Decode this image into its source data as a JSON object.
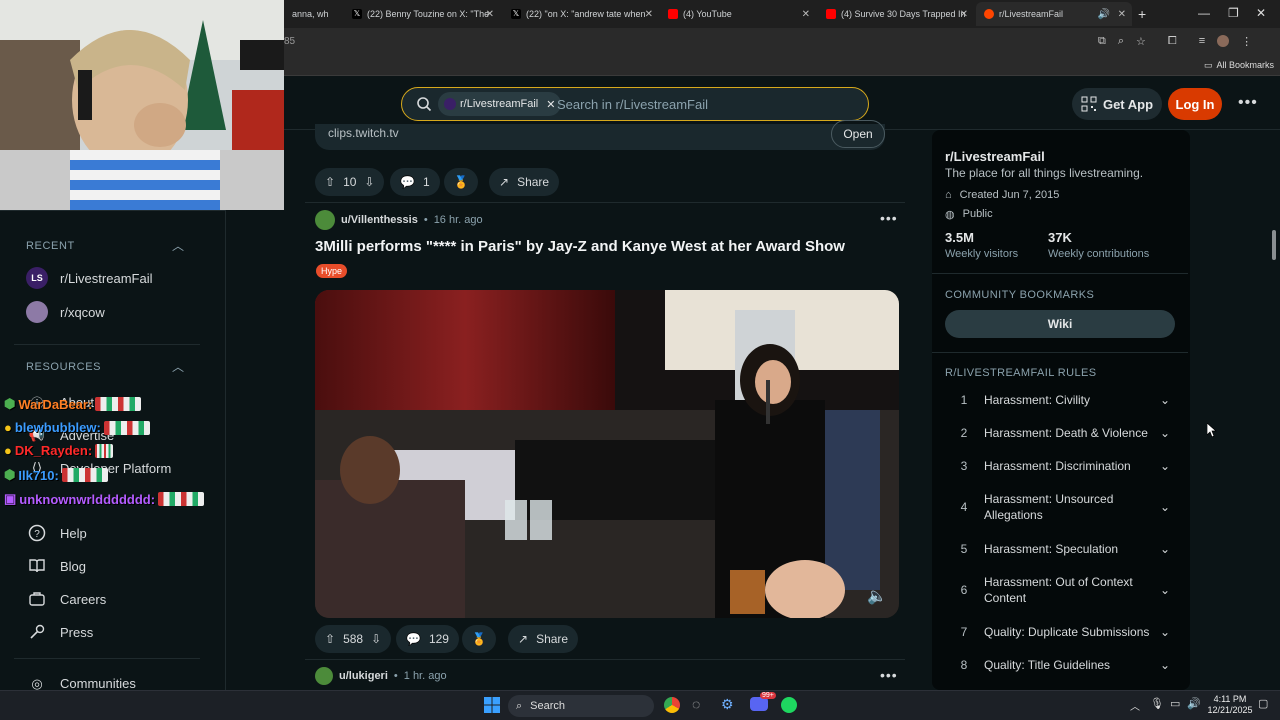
{
  "browser": {
    "tabs": [
      {
        "title": "anna, wh",
        "icon": "x-icon"
      },
      {
        "title": "(22) Benny Touzine on X: \"The",
        "icon": "x-icon"
      },
      {
        "title": "(22) \"on X: \"andrew tate when",
        "icon": "x-icon"
      },
      {
        "title": "(4) YouTube",
        "icon": "youtube-icon"
      },
      {
        "title": "(4) Survive 30 Days Trapped In",
        "icon": "youtube-icon"
      },
      {
        "title": "r/LivestreamFail",
        "icon": "reddit-icon"
      }
    ],
    "address_partial": "85",
    "bookmarks_label": "All Bookmarks"
  },
  "header": {
    "search_chip": "r/LivestreamFail",
    "search_placeholder": "Search in r/LivestreamFail",
    "get_app": "Get App",
    "login": "Log In"
  },
  "sidebar": {
    "recent_title": "RECENT",
    "recent": [
      {
        "label": "r/LivestreamFail",
        "avatar": "LS"
      },
      {
        "label": "r/xqcow",
        "avatar": ""
      }
    ],
    "resources_title": "RESOURCES",
    "resources": [
      {
        "label": "About Reddit",
        "icon": "info-icon"
      },
      {
        "label": "Advertise",
        "icon": "megaphone-icon"
      },
      {
        "label": "Developer Platform",
        "icon": "code-icon"
      },
      {
        "label": "Help",
        "icon": "help-icon"
      },
      {
        "label": "Blog",
        "icon": "book-icon"
      },
      {
        "label": "Careers",
        "icon": "briefcase-icon"
      },
      {
        "label": "Press",
        "icon": "mic-icon"
      },
      {
        "label": "Communities",
        "icon": "communities-icon"
      }
    ]
  },
  "feed": {
    "prev_post": {
      "domain": "clips.twitch.tv",
      "open_label": "Open",
      "votes": "10",
      "comments": "1",
      "share": "Share"
    },
    "post": {
      "author": "u/Villenthessis",
      "sep": "•",
      "time": "16 hr. ago",
      "title": "3Milli performs \"**** in Paris\" by Jay-Z and Kanye West at her Award Show",
      "flair": "Hype",
      "votes": "588",
      "comments": "129",
      "share": "Share"
    },
    "next_post": {
      "author": "u/lukigeri",
      "sep": "•",
      "time": "1 hr. ago"
    }
  },
  "community": {
    "name": "r/LivestreamFail",
    "description": "The place for all things livestreaming.",
    "created": "Created Jun 7, 2015",
    "visibility": "Public",
    "stats": [
      {
        "value": "3.5M",
        "label": "Weekly visitors"
      },
      {
        "value": "37K",
        "label": "Weekly contributions"
      }
    ],
    "bookmarks_title": "COMMUNITY BOOKMARKS",
    "wiki": "Wiki",
    "rules_title": "R/LIVESTREAMFAIL RULES",
    "rules": [
      {
        "num": "1",
        "text": "Harassment: Civility"
      },
      {
        "num": "2",
        "text": "Harassment: Death & Violence"
      },
      {
        "num": "3",
        "text": "Harassment: Discrimination"
      },
      {
        "num": "4",
        "text": "Harassment: Unsourced Allegations"
      },
      {
        "num": "5",
        "text": "Harassment: Speculation"
      },
      {
        "num": "6",
        "text": "Harassment: Out of Context Content"
      },
      {
        "num": "7",
        "text": "Quality: Duplicate Submissions"
      },
      {
        "num": "8",
        "text": "Quality: Title Guidelines"
      }
    ]
  },
  "chat": [
    {
      "user": "WarDaBear:",
      "color": "#ff7f24"
    },
    {
      "user": "blewbubblew:",
      "color": "#3b9cff"
    },
    {
      "user": "DK_Rayden:",
      "color": "#ff2a2a"
    },
    {
      "user": "Ilk710:",
      "color": "#3b9cff"
    },
    {
      "user": "unknownwrlddddddd:",
      "color": "#b45cff"
    }
  ],
  "taskbar": {
    "search": "Search",
    "time": "4:11 PM",
    "date": "12/21/2025",
    "badge": "99+"
  },
  "colors": {
    "reddit_orange": "#d93a00",
    "search_border": "#d7a91c",
    "background": "#0b1416"
  }
}
